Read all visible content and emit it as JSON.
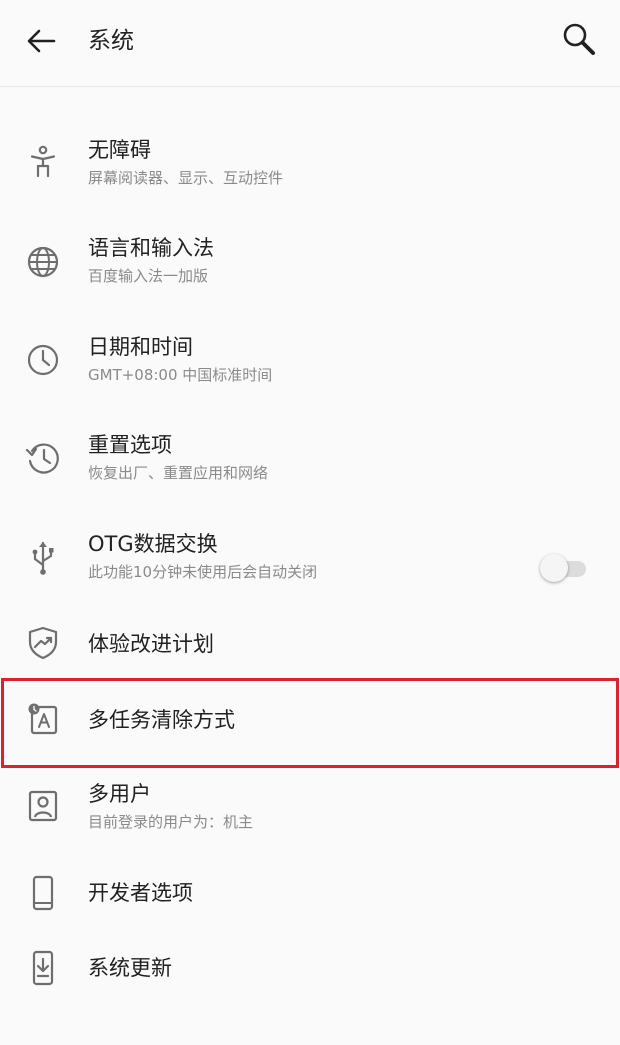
{
  "header": {
    "title": "系统",
    "back_icon": "arrow-back-icon",
    "search_icon": "search-icon"
  },
  "items": [
    {
      "title": "无障碍",
      "subtitle": "屏幕阅读器、显示、互动控件",
      "icon": "accessibility-icon"
    },
    {
      "title": "语言和输入法",
      "subtitle": "百度输入法一加版",
      "icon": "globe-icon"
    },
    {
      "title": "日期和时间",
      "subtitle": "GMT+08:00 中国标准时间",
      "icon": "clock-icon"
    },
    {
      "title": "重置选项",
      "subtitle": "恢复出厂、重置应用和网络",
      "icon": "history-icon"
    },
    {
      "title": "OTG数据交换",
      "subtitle": "此功能10分钟未使用后会自动关闭",
      "icon": "usb-icon",
      "toggle_on": false
    },
    {
      "title": "体验改进计划",
      "icon": "shield-chart-icon"
    },
    {
      "title": "多任务清除方式",
      "icon": "recent-apps-clear-icon",
      "highlighted": true
    },
    {
      "title": "多用户",
      "subtitle": "目前登录的用户为：机主",
      "icon": "user-icon"
    },
    {
      "title": "开发者选项",
      "icon": "phone-icon"
    },
    {
      "title": "系统更新",
      "icon": "system-update-icon"
    }
  ],
  "colors": {
    "highlight_border": "#d9232e",
    "icon": "#6e6e6e",
    "subtitle": "#8a8a8a"
  }
}
